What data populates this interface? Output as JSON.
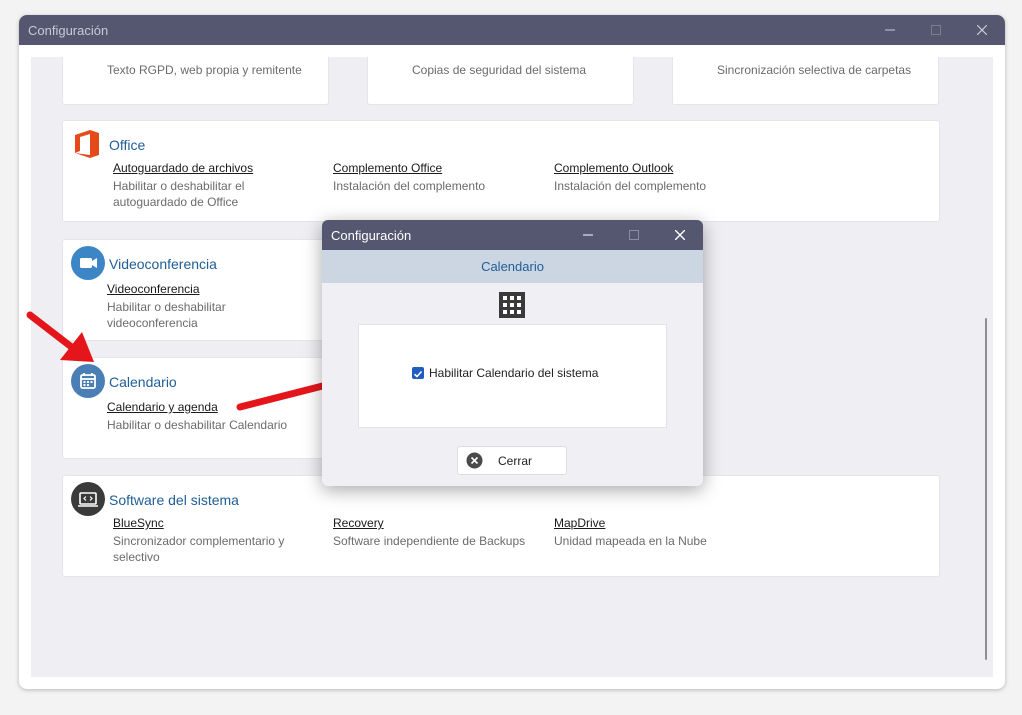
{
  "window": {
    "title": "Configuración"
  },
  "top_cards": [
    {
      "desc": "Texto RGPD, web propia y remitente"
    },
    {
      "desc": "Copias de seguridad del sistema"
    },
    {
      "desc": "Sincronización selectiva de carpetas"
    }
  ],
  "office": {
    "title": "Office",
    "items": [
      {
        "link": "Autoguardado de archivos",
        "desc1": "Habilitar o deshabilitar el",
        "desc2": "autoguardado de Office"
      },
      {
        "link": "Complemento Office",
        "desc1": "Instalación del complemento"
      },
      {
        "link": "Complemento Outlook",
        "desc1": "Instalación del complemento"
      }
    ]
  },
  "video": {
    "title": "Videoconferencia",
    "link": "Videoconferencia",
    "desc1": "Habilitar o deshabilitar",
    "desc2": "videoconferencia"
  },
  "calendar": {
    "title": "Calendario",
    "link": "Calendario y agenda",
    "desc1": "Habilitar o deshabilitar Calendario"
  },
  "software": {
    "title": "Software del sistema",
    "items": [
      {
        "link": "BlueSync",
        "desc1": "Sincronizador complementario y",
        "desc2": "selectivo"
      },
      {
        "link": "Recovery",
        "desc1": "Software independiente de Backups"
      },
      {
        "link": "MapDrive",
        "desc1": "Unidad mapeada en la Nube"
      }
    ]
  },
  "dialog": {
    "title": "Configuración",
    "header": "Calendario",
    "checkbox_label": "Habilitar Calendario del sistema",
    "checkbox_checked": true,
    "close_label": "Cerrar"
  },
  "colors": {
    "titlebar": "#555770",
    "section_title": "#1f5e98",
    "office_icon": "#e64a19",
    "video_icon": "#3d86c6",
    "calendar_icon": "#4a7fb5",
    "software_icon": "#3a3a3a",
    "annotation_arrow": "#e4161b",
    "checkbox": "#1f5ec0"
  },
  "icons": {
    "office": "office-logo-icon",
    "video": "video-camera-icon",
    "calendar": "calendar-icon",
    "software": "laptop-code-icon",
    "dialog_header": "grid-apps-icon",
    "close_button": "close-circle-icon"
  }
}
